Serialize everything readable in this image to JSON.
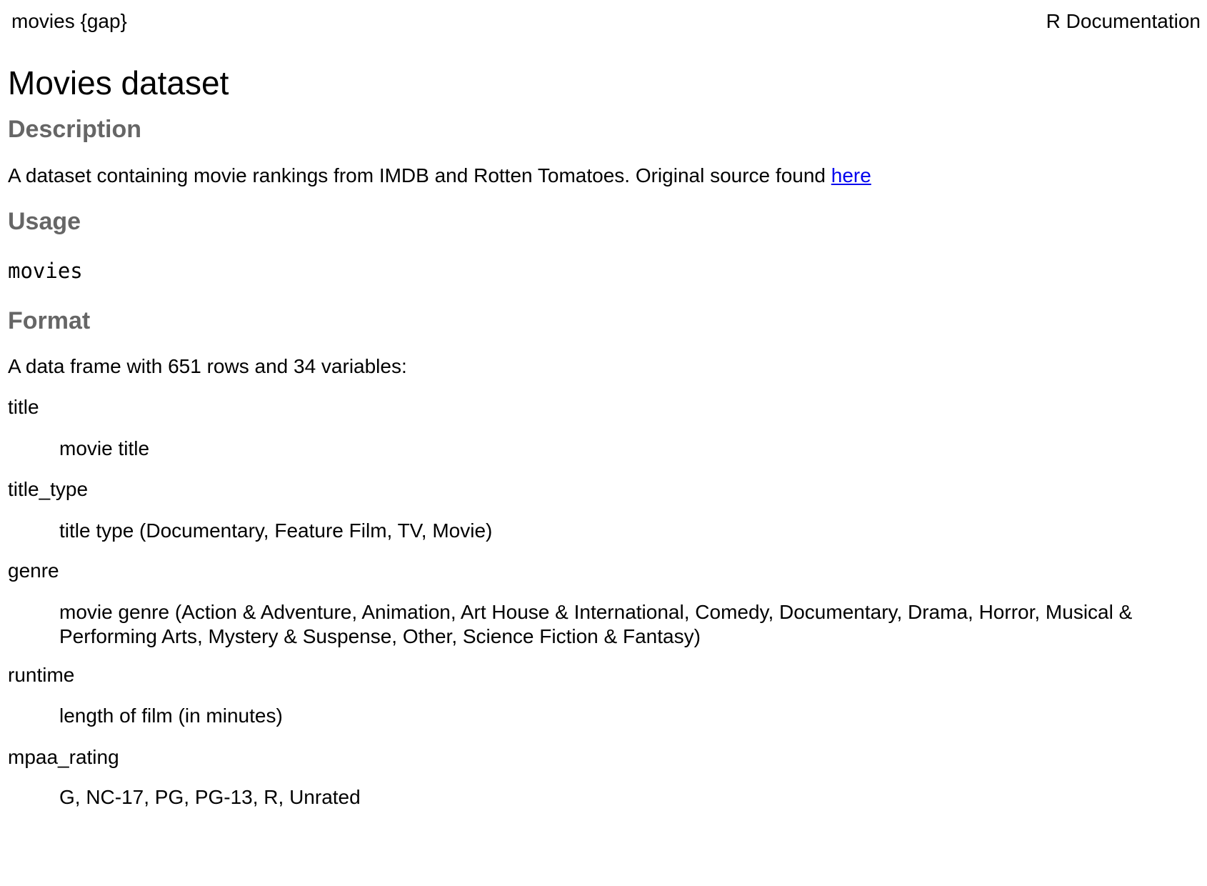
{
  "header": {
    "topic": "movies {gap}",
    "doc_label": "R Documentation"
  },
  "title": "Movies dataset",
  "sections": {
    "description": {
      "heading": "Description",
      "text": "A dataset containing movie rankings from IMDB and Rotten Tomatoes. Original source found ",
      "link_text": "here"
    },
    "usage": {
      "heading": "Usage",
      "code": "movies"
    },
    "format": {
      "heading": "Format",
      "intro": "A data frame with 651 rows and 34 variables:",
      "items": [
        {
          "term": "title",
          "desc": "movie title"
        },
        {
          "term": "title_type",
          "desc": "title type (Documentary, Feature Film, TV, Movie)"
        },
        {
          "term": "genre",
          "desc": "movie genre (Action & Adventure, Animation, Art House & International, Comedy, Documentary, Drama, Horror, Musical & Performing Arts, Mystery & Suspense, Other, Science Fiction & Fantasy)"
        },
        {
          "term": "runtime",
          "desc": "length of film (in minutes)"
        },
        {
          "term": "mpaa_rating",
          "desc": "G, NC-17, PG, PG-13, R, Unrated"
        }
      ]
    }
  }
}
